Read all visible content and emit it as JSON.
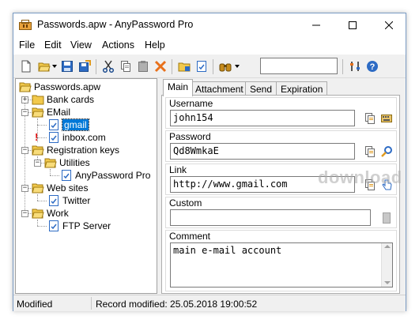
{
  "window": {
    "title": "Passwords.apw - AnyPassword Pro"
  },
  "menu": [
    "File",
    "Edit",
    "View",
    "Actions",
    "Help"
  ],
  "toolbar": {
    "search_value": ""
  },
  "tree": {
    "root": "Passwords.apw",
    "bank_cards": "Bank cards",
    "email": "EMail",
    "gmail": "gmail",
    "inbox": "inbox.com",
    "registration_keys": "Registration keys",
    "utilities": "Utilities",
    "anypassword": "AnyPassword Pro",
    "web_sites": "Web sites",
    "twitter": "Twitter",
    "work": "Work",
    "ftp": "FTP Server"
  },
  "tabs": [
    "Main",
    "Attachment",
    "Send",
    "Expiration"
  ],
  "record": {
    "username_label": "Username",
    "username": "john154",
    "password_label": "Password",
    "password": "Qd8WmkaE",
    "link_label": "Link",
    "link": "http://www.gmail.com",
    "custom_label": "Custom",
    "custom": "",
    "comment_label": "Comment",
    "comment": "main e-mail account"
  },
  "status": {
    "state": "Modified",
    "record_modified": "Record modified: 25.05.2018 19:00:52"
  },
  "watermark": "download",
  "colors": {
    "accent": "#0078d7",
    "folder": "#f2c94c"
  }
}
